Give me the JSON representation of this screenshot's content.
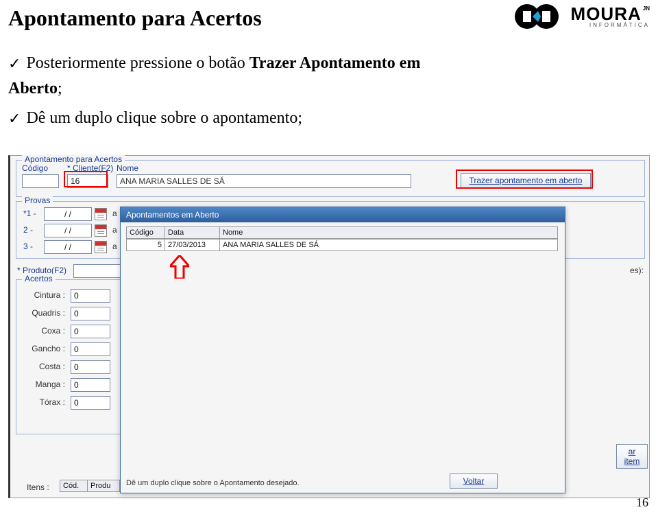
{
  "page": {
    "title": "Apontamento para Acertos",
    "number": "16"
  },
  "logo": {
    "brand": "MOURA",
    "sub": "JN",
    "tag": "INFORMÁTICA"
  },
  "instructions": {
    "line1_a": "Posteriormente  pressione  o  botão  ",
    "line1_b": "Trazer  Apontamento  em",
    "line2_a": "Aberto",
    "line2_b": ";",
    "line3": "Dê um duplo clique sobre o apontamento;"
  },
  "app": {
    "section_main": "Apontamento para Acertos",
    "codigo_lbl": "Código",
    "cliente_lbl": "* Cliente(F2)",
    "cliente_val": "16",
    "nome_lbl": "Nome",
    "nome_val": "ANA MARIA SALLES DE SÁ",
    "btn_trazer": "Trazer apontamento em aberto",
    "section_provas": "Provas",
    "prova_rows": [
      "*1 -",
      "2 -",
      "3 -"
    ],
    "prova_date": "/  /",
    "prova_as": "a",
    "produto_lbl": "* Produto(F2)",
    "es_hint": "es):",
    "section_acertos": "Acertos",
    "measures": [
      {
        "label": "Cintura :",
        "value": "0"
      },
      {
        "label": "Quadris :",
        "value": "0"
      },
      {
        "label": "Coxa :",
        "value": "0"
      },
      {
        "label": "Gancho :",
        "value": "0"
      },
      {
        "label": "Costa :",
        "value": "0"
      },
      {
        "label": "Manga :",
        "value": "0"
      },
      {
        "label": "Tórax :",
        "value": "0"
      }
    ],
    "btn_item": "ar item",
    "itens_lbl": "Itens :",
    "itens_cols": [
      "Cód.",
      "Produ"
    ]
  },
  "dialog": {
    "title": "Apontamentos em Aberto",
    "cols": [
      "Código",
      "Data",
      "Nome"
    ],
    "row": {
      "codigo": "5",
      "data": "27/03/2013",
      "nome": "ANA MARIA SALLES DE SÁ"
    },
    "hint": "Dê um duplo clique sobre o Apontamento desejado.",
    "btn_voltar": "Voltar"
  }
}
